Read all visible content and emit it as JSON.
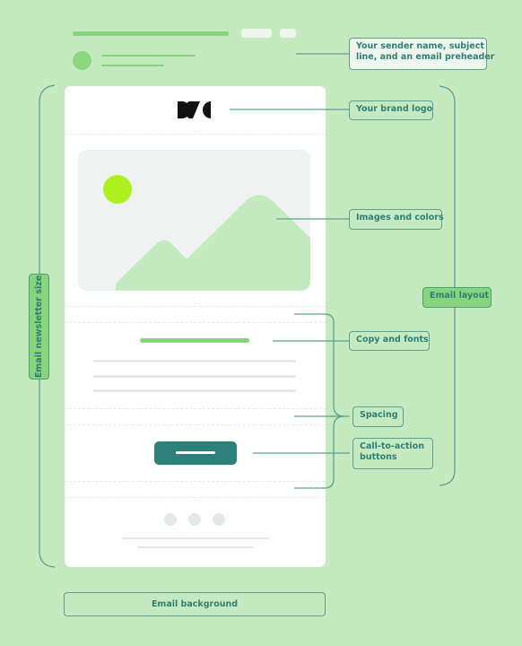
{
  "colors": {
    "background": "#c5eac0",
    "card": "#ffffff",
    "accent_green": "#86d47d",
    "teal": "#2f7f77",
    "sun": "#aef020",
    "placeholder_gray": "#e4e8e8",
    "image_bg": "#eef2f1",
    "cta": "#2e807b"
  },
  "inbox_preview": {
    "subject_bar": "subject-line-placeholder",
    "sender_avatar": "avatar-placeholder"
  },
  "email": {
    "logo_icon": "brand-logo-icon",
    "hero_image_icon": "mountain-image-icon",
    "cta_button": "call-to-action-button",
    "social_icons": [
      "social-icon",
      "social-icon",
      "social-icon"
    ]
  },
  "annotations": {
    "sender": "Your sender name, subject line, and an email preheader",
    "sender_line1": "Your sender name, subject",
    "sender_line2": "line, and an email preheader",
    "logo": "Your brand logo",
    "images": "Images and colors",
    "layout": "Email layout",
    "copy": "Copy and fonts",
    "spacing": "Spacing",
    "cta": "Call-to-action buttons",
    "cta_line1": "Call-to-action",
    "cta_line2": "buttons",
    "size": "Email newsletter size",
    "background": "Email background"
  }
}
